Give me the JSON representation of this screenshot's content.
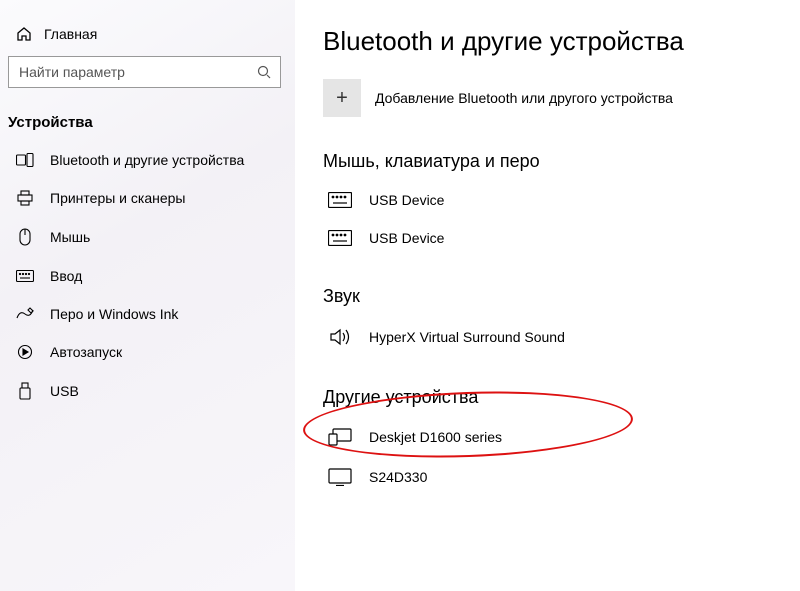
{
  "sidebar": {
    "home_label": "Главная",
    "search_placeholder": "Найти параметр",
    "section_title": "Устройства",
    "items": [
      {
        "label": "Bluetooth и другие устройства"
      },
      {
        "label": "Принтеры и сканеры"
      },
      {
        "label": "Мышь"
      },
      {
        "label": "Ввод"
      },
      {
        "label": "Перо и Windows Ink"
      },
      {
        "label": "Автозапуск"
      },
      {
        "label": "USB"
      }
    ]
  },
  "main": {
    "title": "Bluetooth и другие устройства",
    "add_label": "Добавление Bluetooth или другого устройства",
    "groups": [
      {
        "title": "Мышь, клавиатура и перо",
        "devices": [
          {
            "name": "USB Device",
            "icon": "keyboard"
          },
          {
            "name": "USB Device",
            "icon": "keyboard"
          }
        ]
      },
      {
        "title": "Звук",
        "devices": [
          {
            "name": "HyperX Virtual Surround Sound",
            "icon": "speaker"
          }
        ]
      },
      {
        "title": "Другие устройства",
        "devices": [
          {
            "name": "Deskjet D1600 series",
            "icon": "multi"
          },
          {
            "name": "S24D330",
            "icon": "monitor"
          }
        ]
      }
    ]
  }
}
